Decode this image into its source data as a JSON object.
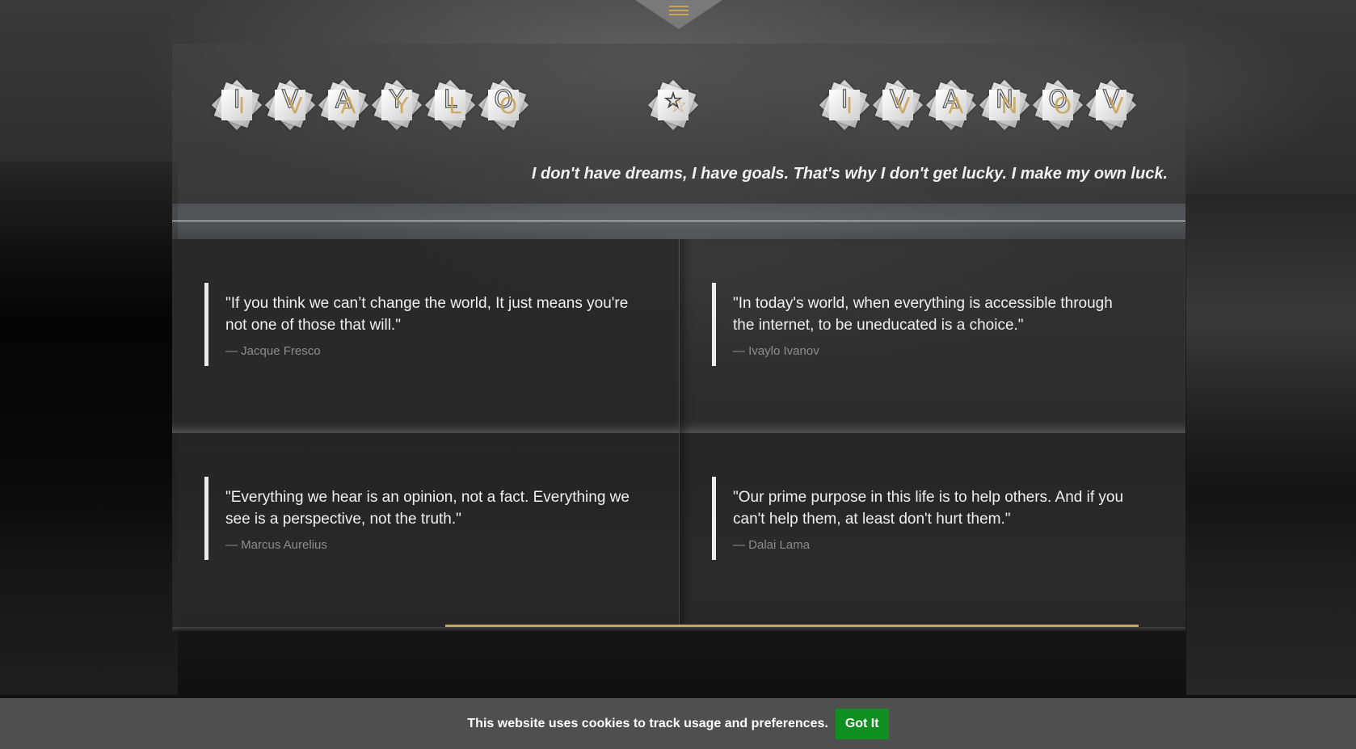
{
  "menu": {
    "icon": "hamburger-icon",
    "accent_color": "#c9a45b"
  },
  "header": {
    "first_name_letters": [
      "I",
      "V",
      "A",
      "Y",
      "L",
      "O"
    ],
    "separator_icon": "☆",
    "last_name_letters": [
      "I",
      "V",
      "A",
      "N",
      "O",
      "V"
    ],
    "motto": "I don't have dreams, I have goals. That's why I don't get lucky. I make my own luck."
  },
  "quotes": [
    {
      "text": "\"If you think we can’t change the world, It just means you're not one of those that will.\"",
      "author": "— Jacque Fresco"
    },
    {
      "text": "\"In today's world, when everything is accessible through the internet, to be uneducated is a choice.\"",
      "author": "— Ivaylo Ivanov"
    },
    {
      "text": "\"Everything we hear is an opinion, not a fact. Everything we see is a perspective, not the truth.\"",
      "author": "— Marcus Aurelius"
    },
    {
      "text": "\"Our prime purpose in this life is to help others. And if you can't help them, at least don't hurt them.\"",
      "author": "— Dalai Lama"
    }
  ],
  "cookie": {
    "message": "This website uses cookies to track usage and preferences.",
    "button_label": "Got It",
    "button_color": "#0f8f1f"
  }
}
